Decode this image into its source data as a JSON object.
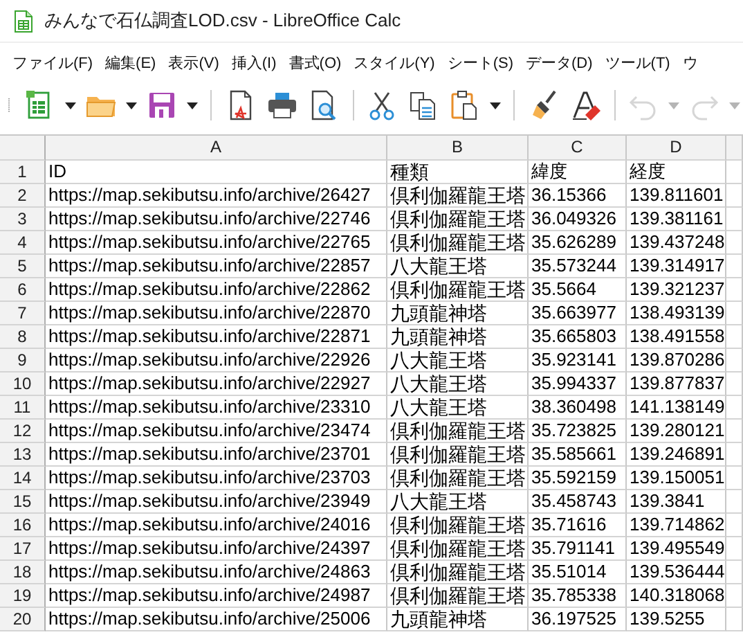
{
  "window": {
    "title": "みんなで石仏調査LOD.csv - LibreOffice Calc"
  },
  "menu": [
    {
      "label": "ファイル(F)"
    },
    {
      "label": "編集(E)"
    },
    {
      "label": "表示(V)"
    },
    {
      "label": "挿入(I)"
    },
    {
      "label": "書式(O)"
    },
    {
      "label": "スタイル(Y)"
    },
    {
      "label": "シート(S)"
    },
    {
      "label": "データ(D)"
    },
    {
      "label": "ツール(T)"
    },
    {
      "label": "ウ"
    }
  ],
  "toolbar": [
    {
      "kind": "new",
      "dropdown": true,
      "disabled": false
    },
    {
      "kind": "open",
      "dropdown": true,
      "disabled": false
    },
    {
      "kind": "save",
      "dropdown": true,
      "disabled": false
    },
    {
      "kind": "separator"
    },
    {
      "kind": "pdf",
      "dropdown": false,
      "disabled": false
    },
    {
      "kind": "print",
      "dropdown": false,
      "disabled": false
    },
    {
      "kind": "preview",
      "dropdown": false,
      "disabled": false
    },
    {
      "kind": "separator"
    },
    {
      "kind": "cut",
      "dropdown": false,
      "disabled": false
    },
    {
      "kind": "copy",
      "dropdown": false,
      "disabled": false
    },
    {
      "kind": "paste",
      "dropdown": true,
      "disabled": false
    },
    {
      "kind": "separator"
    },
    {
      "kind": "brush",
      "dropdown": false,
      "disabled": false
    },
    {
      "kind": "clear",
      "dropdown": false,
      "disabled": false
    },
    {
      "kind": "separator"
    },
    {
      "kind": "undo",
      "dropdown": true,
      "disabled": true
    },
    {
      "kind": "redo",
      "dropdown": true,
      "disabled": true
    }
  ],
  "sheet": {
    "columns": [
      "A",
      "B",
      "C",
      "D"
    ],
    "rows": [
      {
        "number": "1",
        "cells": [
          "ID",
          "種類",
          "緯度",
          "経度"
        ]
      },
      {
        "number": "2",
        "cells": [
          "https://map.sekibutsu.info/archive/26427",
          "倶利伽羅龍王塔",
          "36.15366",
          "139.811601"
        ]
      },
      {
        "number": "3",
        "cells": [
          "https://map.sekibutsu.info/archive/22746",
          "倶利伽羅龍王塔",
          "36.049326",
          "139.381161"
        ]
      },
      {
        "number": "4",
        "cells": [
          "https://map.sekibutsu.info/archive/22765",
          "倶利伽羅龍王塔",
          "35.626289",
          "139.437248"
        ]
      },
      {
        "number": "5",
        "cells": [
          "https://map.sekibutsu.info/archive/22857",
          "八大龍王塔",
          "35.573244",
          "139.314917"
        ]
      },
      {
        "number": "6",
        "cells": [
          "https://map.sekibutsu.info/archive/22862",
          "倶利伽羅龍王塔",
          "35.5664",
          "139.321237"
        ]
      },
      {
        "number": "7",
        "cells": [
          "https://map.sekibutsu.info/archive/22870",
          "九頭龍神塔",
          "35.663977",
          "138.493139"
        ]
      },
      {
        "number": "8",
        "cells": [
          "https://map.sekibutsu.info/archive/22871",
          "九頭龍神塔",
          "35.665803",
          "138.491558"
        ]
      },
      {
        "number": "9",
        "cells": [
          "https://map.sekibutsu.info/archive/22926",
          "八大龍王塔",
          "35.923141",
          "139.870286"
        ]
      },
      {
        "number": "10",
        "cells": [
          "https://map.sekibutsu.info/archive/22927",
          "八大龍王塔",
          "35.994337",
          "139.877837"
        ]
      },
      {
        "number": "11",
        "cells": [
          "https://map.sekibutsu.info/archive/23310",
          "八大龍王塔",
          "38.360498",
          "141.138149"
        ]
      },
      {
        "number": "12",
        "cells": [
          "https://map.sekibutsu.info/archive/23474",
          "倶利伽羅龍王塔",
          "35.723825",
          "139.280121"
        ]
      },
      {
        "number": "13",
        "cells": [
          "https://map.sekibutsu.info/archive/23701",
          "倶利伽羅龍王塔",
          "35.585661",
          "139.246891"
        ]
      },
      {
        "number": "14",
        "cells": [
          "https://map.sekibutsu.info/archive/23703",
          "倶利伽羅龍王塔",
          "35.592159",
          "139.150051"
        ]
      },
      {
        "number": "15",
        "cells": [
          "https://map.sekibutsu.info/archive/23949",
          "八大龍王塔",
          "35.458743",
          "139.3841"
        ]
      },
      {
        "number": "16",
        "cells": [
          "https://map.sekibutsu.info/archive/24016",
          "倶利伽羅龍王塔",
          "35.71616",
          "139.714862"
        ]
      },
      {
        "number": "17",
        "cells": [
          "https://map.sekibutsu.info/archive/24397",
          "倶利伽羅龍王塔",
          "35.791141",
          "139.495549"
        ]
      },
      {
        "number": "18",
        "cells": [
          "https://map.sekibutsu.info/archive/24863",
          "倶利伽羅龍王塔",
          "35.51014",
          "139.536444"
        ]
      },
      {
        "number": "19",
        "cells": [
          "https://map.sekibutsu.info/archive/24987",
          "倶利伽羅龍王塔",
          "35.785338",
          "140.318068"
        ]
      },
      {
        "number": "20",
        "cells": [
          "https://map.sekibutsu.info/archive/25006",
          "九頭龍神塔",
          "36.197525",
          "139.5255"
        ]
      }
    ]
  }
}
